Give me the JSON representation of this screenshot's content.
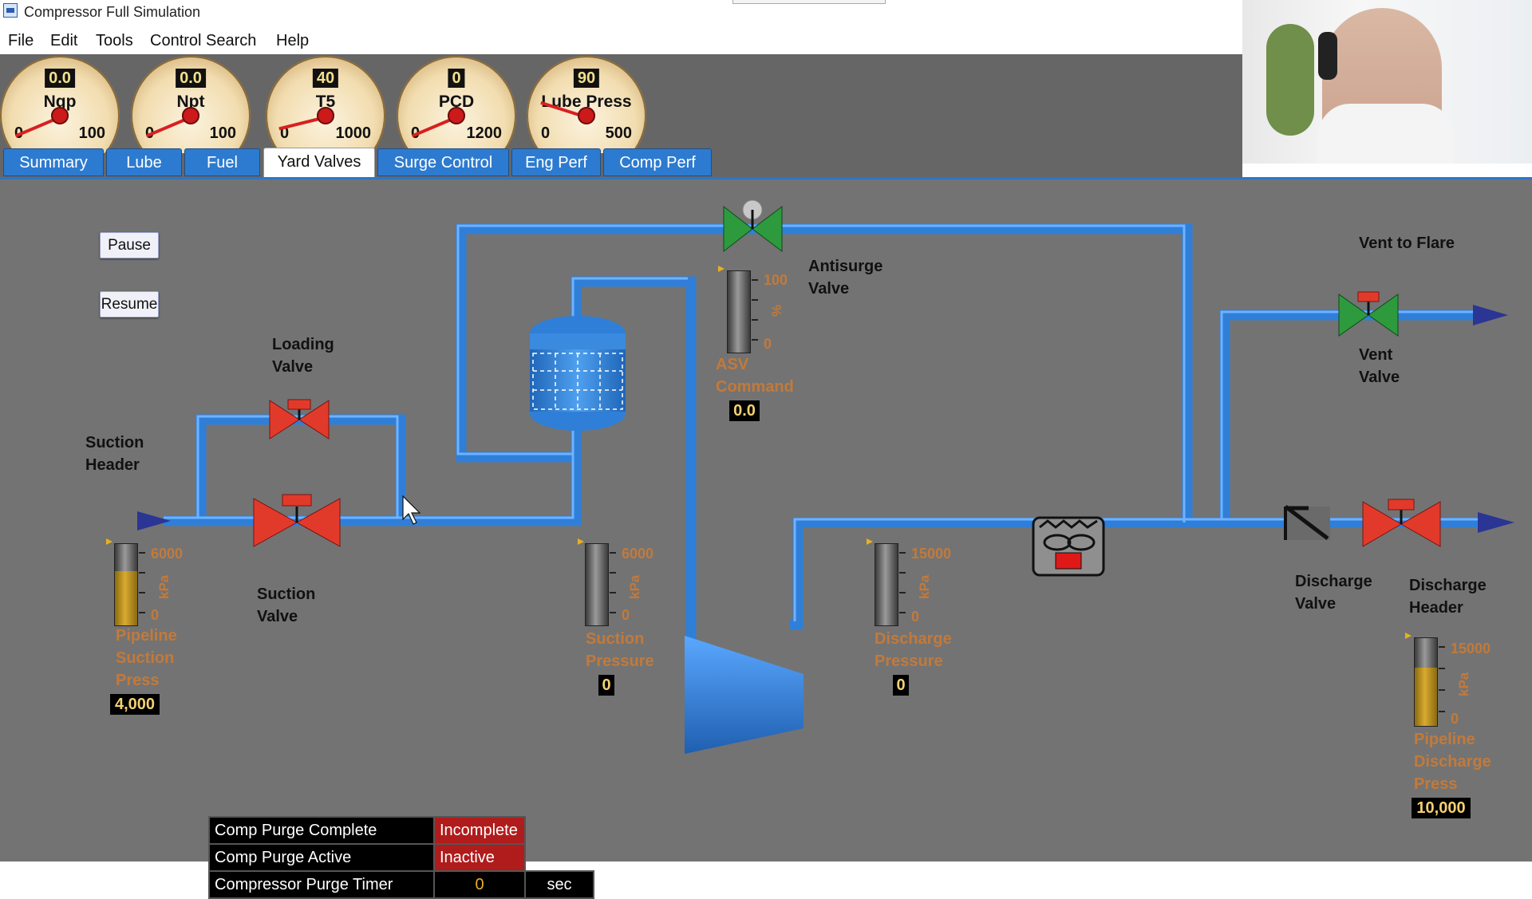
{
  "window": {
    "title": "Compressor Full Simulation"
  },
  "menu": [
    "File",
    "Edit",
    "Tools",
    "Control Search",
    "Help"
  ],
  "gauges": [
    {
      "label": "Ngp",
      "value": "0.0",
      "min": "0",
      "max": "100",
      "reading": 0
    },
    {
      "label": "Npt",
      "value": "0.0",
      "min": "0",
      "max": "100",
      "reading": 0
    },
    {
      "label": "T5",
      "value": "40",
      "min": "0",
      "max": "1000",
      "reading": 40
    },
    {
      "label": "PCD",
      "value": "0",
      "min": "0",
      "max": "1200",
      "reading": 0
    },
    {
      "label": "Lube Press",
      "value": "90",
      "min": "0",
      "max": "500",
      "reading": 90
    }
  ],
  "tabs": [
    "Summary",
    "Lube",
    "Fuel",
    "Yard Valves",
    "Surge Control",
    "Eng Perf",
    "Comp Perf"
  ],
  "active_tab": "Yard Valves",
  "buttons": {
    "pause": "Pause",
    "resume": "Resume"
  },
  "labels": {
    "loading_valve": [
      "Loading",
      "Valve"
    ],
    "suction_header": [
      "Suction",
      "Header"
    ],
    "suction_valve": [
      "Suction",
      "Valve"
    ],
    "antisurge_valve": [
      "Antisurge",
      "Valve"
    ],
    "vent_to_flare": "Vent to Flare",
    "vent_valve": [
      "Vent",
      "Valve"
    ],
    "discharge_valve": [
      "Discharge",
      "Valve"
    ],
    "discharge_header": [
      "Discharge",
      "Header"
    ]
  },
  "indicators": {
    "asv_command": {
      "label": [
        "ASV",
        "Command"
      ],
      "max": "100",
      "min": "0",
      "unit": "%",
      "value": "0.0",
      "fill": 0
    },
    "pipeline_suction": {
      "label": [
        "Pipeline",
        "Suction",
        "Press"
      ],
      "max": "6000",
      "min": "0",
      "unit": "kPa",
      "value": "4,000",
      "fill": 0.667
    },
    "suction_pressure": {
      "label": [
        "Suction",
        "Pressure"
      ],
      "max": "6000",
      "min": "0",
      "unit": "kPa",
      "value": "0",
      "fill": 0
    },
    "discharge_pressure": {
      "label": [
        "Discharge",
        "Pressure"
      ],
      "max": "15000",
      "min": "0",
      "unit": "kPa",
      "value": "0",
      "fill": 0
    },
    "pipeline_discharge": {
      "label": [
        "Pipeline",
        "Discharge",
        "Press"
      ],
      "max": "15000",
      "min": "0",
      "unit": "kPa",
      "value": "10,000",
      "fill": 0.667
    }
  },
  "status": [
    {
      "name": "Comp Purge Complete",
      "value": "Incomplete"
    },
    {
      "name": "Comp Purge Active",
      "value": "Inactive"
    }
  ],
  "timer": {
    "name": "Compressor Purge Timer",
    "value": "0",
    "unit": "sec"
  },
  "colors": {
    "pipe": "#3e8fe6",
    "valve_closed": "#e03030",
    "valve_open": "#2e9a3e",
    "content_bg": "#737373",
    "accent": "#2b76c9"
  }
}
